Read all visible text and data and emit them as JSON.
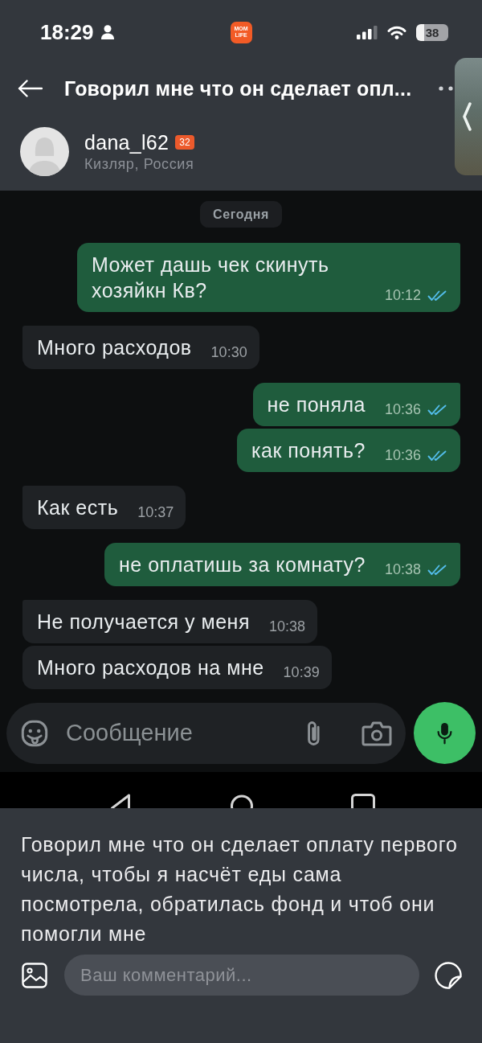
{
  "status_bar": {
    "time": "18:29",
    "app_logo": "MOM LIFE",
    "battery": "38"
  },
  "header": {
    "title": "Говорил мне что он сделает опл..."
  },
  "author": {
    "name": "dana_l62",
    "badge": "32",
    "location": "Кизляр, Россия"
  },
  "chat_screenshot": {
    "date_label": "Сегодня",
    "messages": [
      {
        "kind": "outgoing",
        "text": "Может дашь чек скинуть хозяйкн Кв?",
        "time": "10:12",
        "read": true,
        "tail": true
      },
      {
        "kind": "incoming",
        "text": "Много расходов",
        "time": "10:30",
        "tail": true
      },
      {
        "kind": "outgoing",
        "text": "не поняла",
        "time": "10:36",
        "read": true,
        "tail": true
      },
      {
        "kind": "outgoing",
        "text": "как понять?",
        "time": "10:36",
        "read": true,
        "tail": false
      },
      {
        "kind": "incoming",
        "text": "Как есть",
        "time": "10:37",
        "tail": true
      },
      {
        "kind": "outgoing",
        "text": "не оплатишь за комнату?",
        "time": "10:38",
        "read": true,
        "tail": true
      },
      {
        "kind": "incoming",
        "text": "Не получается у меня",
        "time": "10:38",
        "tail": true
      },
      {
        "kind": "incoming",
        "text": "Много расходов на мне",
        "time": "10:39",
        "tail": false
      }
    ],
    "composer": {
      "placeholder": "Сообщение"
    }
  },
  "post": {
    "text": "Говорил мне что он сделает оплату первого числа, чтобы я насчёт еды сама посмотрела, обратилась фонд и чтоб они помогли мне"
  },
  "comment_bar": {
    "placeholder": "Ваш комментарий..."
  }
}
